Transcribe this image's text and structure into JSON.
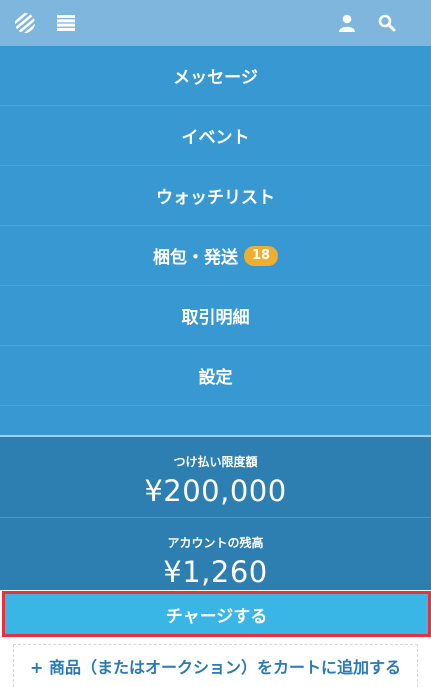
{
  "menu": {
    "items": [
      {
        "label": "メッセージ"
      },
      {
        "label": "イベント"
      },
      {
        "label": "ウォッチリスト"
      },
      {
        "label": "梱包・発送",
        "badge": "18"
      },
      {
        "label": "取引明細"
      },
      {
        "label": "設定"
      }
    ]
  },
  "balances": {
    "credit_limit_label": "つけ払い限度額",
    "credit_limit_value": "¥200,000",
    "account_balance_label": "アカウントの残高",
    "account_balance_value": "¥1,260"
  },
  "actions": {
    "charge_label": "チャージする",
    "add_to_cart_label": "+ 商品（またはオークション）をカートに追加する"
  },
  "colors": {
    "topbar": "#7fb6dd",
    "menu_bg": "#3899d2",
    "balance_bg": "#2d7fb2",
    "charge_bg": "#39b5e6",
    "highlight_border": "#e7323d",
    "badge": "#f0ad2e",
    "link": "#2a7ab7"
  },
  "icons": {
    "logo": "striped-globe-logo-icon",
    "menu": "hamburger-menu-icon",
    "user": "user-icon",
    "search": "search-icon"
  }
}
